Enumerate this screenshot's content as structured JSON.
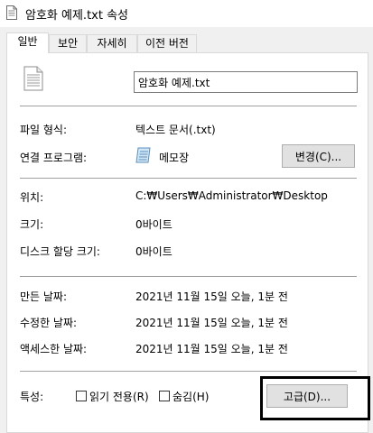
{
  "window": {
    "title": "암호화 예제.txt 속성",
    "icon": "text-file-icon"
  },
  "tabs": [
    {
      "label": "일반",
      "active": true
    },
    {
      "label": "보안",
      "active": false
    },
    {
      "label": "자세히",
      "active": false
    },
    {
      "label": "이전 버전",
      "active": false
    }
  ],
  "general": {
    "file_icon": "text-document-icon",
    "file_name": "암호화 예제.txt",
    "file_type_label": "파일 형식:",
    "file_type_value": "텍스트 문서(.txt)",
    "open_with_label": "연결 프로그램:",
    "open_with_icon": "notepad-icon",
    "open_with_value": "메모장",
    "change_button": "변경(C)...",
    "location_label": "위치:",
    "location_value": "C:₩Users₩Administrator₩Desktop",
    "size_label": "크기:",
    "size_value": "0바이트",
    "disk_size_label": "디스크 할당 크기:",
    "disk_size_value": "0바이트",
    "created_label": "만든 날짜:",
    "created_value": "2021년 11월 15일 오늘, 1분 전",
    "modified_label": "수정한 날짜:",
    "modified_value": "2021년 11월 15일 오늘, 1분 전",
    "accessed_label": "액세스한 날짜:",
    "accessed_value": "2021년 11월 15일 오늘, 1분 전",
    "attributes_label": "특성:",
    "readonly_label": "읽기 전용(R)",
    "readonly_checked": false,
    "hidden_label": "숨김(H)",
    "hidden_checked": false,
    "advanced_button": "고급(D)..."
  },
  "colors": {
    "window_bg": "#f0f0f0",
    "panel_bg": "#ffffff",
    "button_bg": "#e1e1e1",
    "highlight": "#000000"
  }
}
